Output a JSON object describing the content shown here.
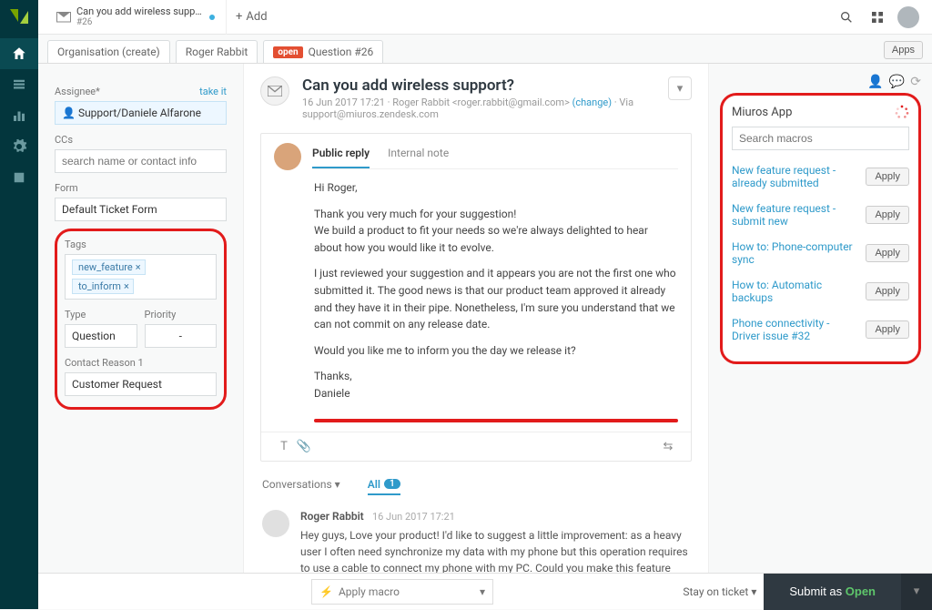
{
  "topbar": {
    "tab_title": "Can you add wireless suppo...",
    "tab_sub": "#26",
    "add_label": "Add"
  },
  "secbar": {
    "crumb1": "Organisation (create)",
    "crumb2": "Roger Rabbit",
    "open_badge": "open",
    "crumb3": "Question #26",
    "apps": "Apps"
  },
  "left": {
    "assignee_label": "Assignee",
    "take_it": "take it",
    "assignee_value": "Support/Daniele Alfarone",
    "ccs_label": "CCs",
    "ccs_placeholder": "search name or contact info",
    "form_label": "Form",
    "form_value": "Default Ticket Form",
    "tags_label": "Tags",
    "tags": [
      "new_feature",
      "to_inform"
    ],
    "type_label": "Type",
    "type_value": "Question",
    "priority_label": "Priority",
    "priority_value": "-",
    "reason_label": "Contact Reason 1",
    "reason_value": "Customer Request"
  },
  "ticket": {
    "subject": "Can you add wireless support?",
    "date": "16 Jun 2017 17:21",
    "requester_name": "Roger Rabbit",
    "requester_email": "<roger.rabbit@gmail.com>",
    "change": "(change)",
    "via": "Via",
    "via_email": "support@miuros.zendesk.com"
  },
  "reply": {
    "public_tab": "Public reply",
    "internal_tab": "Internal note",
    "p1": "Hi Roger,",
    "p2": "Thank you very much for your suggestion!",
    "p3": "We build a product to fit your needs so we're always delighted to hear about how you would like it to evolve.",
    "p4": "I just reviewed your suggestion and it appears you are not the first one who submitted it. The good news is that our product team approved it already and they have it in their pipe. Nonetheless, I'm sure you understand that we can not commit on any release date.",
    "p5": "Would you like me to inform you the day we release it?",
    "p6": "Thanks,",
    "p7": "Daniele"
  },
  "conv": {
    "label": "Conversations",
    "filter": "All",
    "count": "1"
  },
  "message": {
    "author": "Roger Rabbit",
    "time": "16 Jun 2017 17:21",
    "body": "Hey guys, Love your product! I'd like to suggest a little improvement: as a heavy user I often need synchronize my data with my phone but this operation requires to use a cable to connect my phone with my PC. Could you make this feature through a wireless connection? Thanks"
  },
  "miuros": {
    "title": "Miuros App",
    "search_placeholder": "Search macros",
    "macros": [
      "New feature request - already submitted",
      "New feature request - submit new",
      "How to: Phone-computer sync",
      "How to: Automatic backups",
      "Phone connectivity - Driver issue #32"
    ],
    "apply": "Apply"
  },
  "bottom": {
    "apply_macro": "Apply macro",
    "stay": "Stay on ticket",
    "submit_prefix": "Submit as ",
    "submit_state": "Open"
  }
}
